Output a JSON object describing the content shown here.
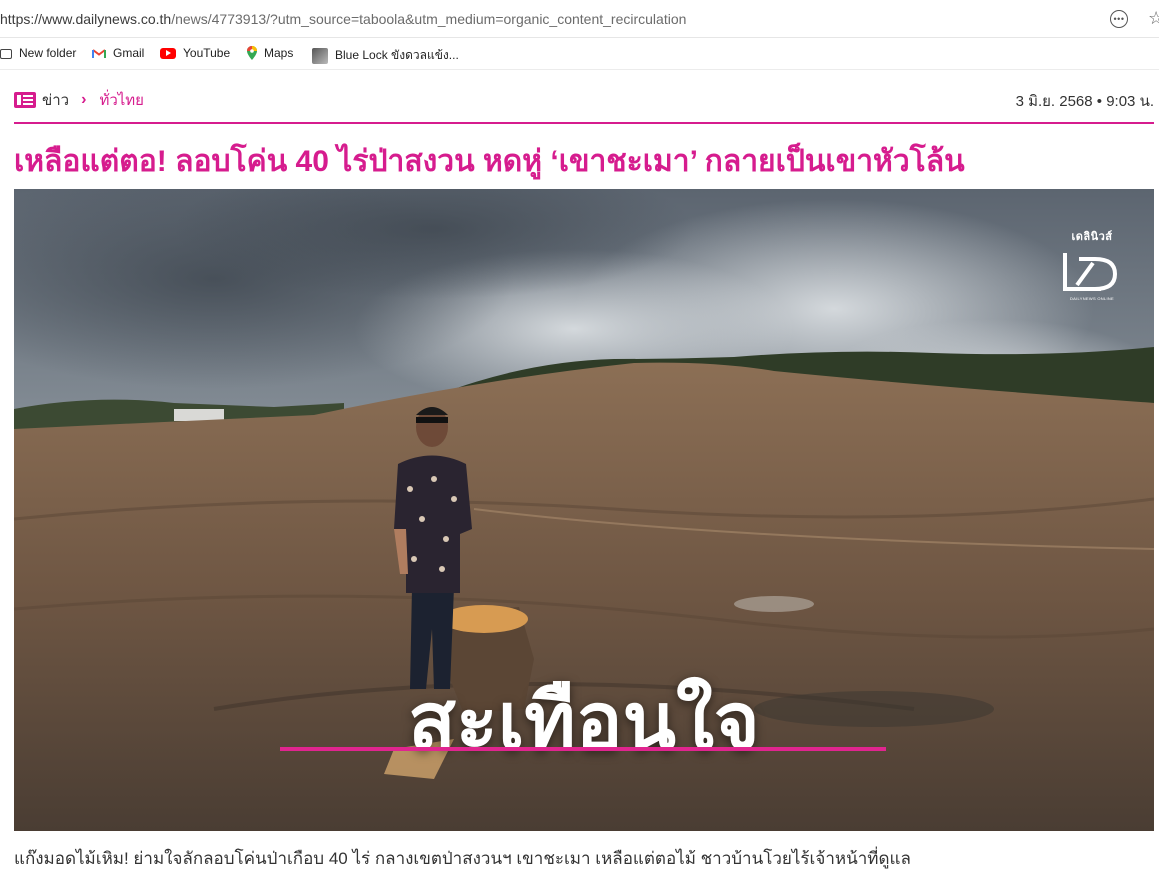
{
  "browser": {
    "url_host": "https://www.dailynews.co.th",
    "url_path": "/news/4773913/?utm_source=taboola&utm_medium=organic_content_recirculation",
    "reader_icon": "more-dots-icon",
    "star_icon": "bookmark-star-icon"
  },
  "bookmarks": [
    {
      "label": "New folder",
      "icon": "folder-icon"
    },
    {
      "label": "Gmail",
      "icon": "gmail-icon"
    },
    {
      "label": "YouTube",
      "icon": "youtube-icon"
    },
    {
      "label": "Maps",
      "icon": "maps-icon"
    },
    {
      "label": "Blue Lock ขังดวลแข้ง...",
      "icon": "blue-lock-icon"
    }
  ],
  "breadcrumb": {
    "home": "ข่าว",
    "separator": "›",
    "category": "ทั่วไทย"
  },
  "article": {
    "date": "3 มิ.ย. 2568 • 9:03 น.",
    "headline": "เหลือแต่ตอ! ลอบโค่น 40 ไร่ป่าสงวน หดหู่ ‘เขาชะเมา’ กลายเป็นเขาหัวโล้น",
    "image_overlay": "สะเทือนใจ",
    "image_brand": "เดลินิวส์",
    "image_brand_sub": "DAILYNEWS ONLINE",
    "caption": "แก๊งมอดไม้เหิม! ย่ามใจลักลอบโค่นป่าเกือบ 40 ไร่ กลางเขตป่าสงวนฯ เขาชะเมา เหลือแต่ตอไม้ ชาวบ้านโวยไร้เจ้าหน้าที่ดูแล"
  },
  "colors": {
    "brand_pink": "#d61c8e",
    "text": "#333333"
  }
}
